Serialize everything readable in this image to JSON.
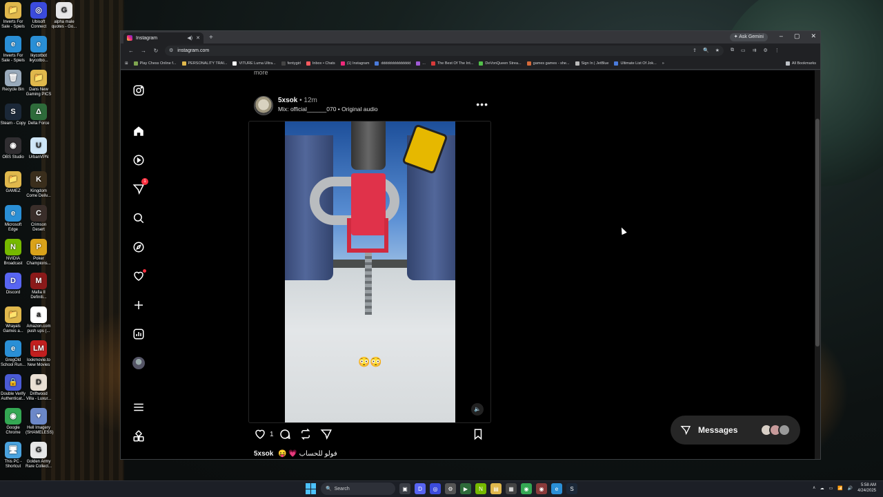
{
  "desktop": {
    "icons": [
      {
        "label": "Inverts For Sale - Spiels",
        "glyph": "📁",
        "color": "#e0b84c"
      },
      {
        "label": "Ubisoft Connect",
        "glyph": "◎",
        "color": "#3b4bdc"
      },
      {
        "label": "alpha male quotes - Go...",
        "glyph": "G",
        "color": "#e7e7e7"
      },
      {
        "label": "Inverts For Sale - Spiels",
        "glyph": "e",
        "color": "#2a8fd6"
      },
      {
        "label": "Ikycotbot Ikycotbo...",
        "glyph": "e",
        "color": "#2a8fd6"
      },
      {
        "label": "Recycle Bin",
        "glyph": "🗑",
        "color": "#9ab"
      },
      {
        "label": "Dans New Gaming PICS",
        "glyph": "📁",
        "color": "#e0b84c"
      },
      {
        "label": "Steam - Copy",
        "glyph": "S",
        "color": "#1b2838"
      },
      {
        "label": "Delta Force",
        "glyph": "Δ",
        "color": "#2e6b3a"
      },
      {
        "label": "OBS Studio",
        "glyph": "◉",
        "color": "#302e31"
      },
      {
        "label": "UrbanVPN",
        "glyph": "U",
        "color": "#cfe6f7"
      },
      {
        "label": "GAMEZ",
        "glyph": "📁",
        "color": "#e0b84c"
      },
      {
        "label": "Kingdom Come Deliv...",
        "glyph": "K",
        "color": "#3a2e1c"
      },
      {
        "label": "Microsoft Edge",
        "glyph": "e",
        "color": "#2a8fd6"
      },
      {
        "label": "Crimson Desert",
        "glyph": "C",
        "color": "#3a2e2a"
      },
      {
        "label": "NVIDIA Broadcast",
        "glyph": "N",
        "color": "#76b900"
      },
      {
        "label": "Poker Champions...",
        "glyph": "P",
        "color": "#d9a21a"
      },
      {
        "label": "Discord",
        "glyph": "D",
        "color": "#5865f2"
      },
      {
        "label": "Mafia II Definiti...",
        "glyph": "M",
        "color": "#8b1a1a"
      },
      {
        "label": "Wrayals Games a...",
        "glyph": "📁",
        "color": "#e0b84c"
      },
      {
        "label": "Amazon.com push ups (...",
        "glyph": "a",
        "color": "#ffffff"
      },
      {
        "label": "GregOld School Run...",
        "glyph": "e",
        "color": "#2a8fd6"
      },
      {
        "label": "lookmovie.to New Movies",
        "glyph": "LM",
        "color": "#c21f1f"
      },
      {
        "label": "Double Verify Authenticat...",
        "glyph": "🔒",
        "color": "#4a5bd6"
      },
      {
        "label": "Driftwood Villa - Luxur...",
        "glyph": "D",
        "color": "#e9e0d4"
      },
      {
        "label": "Google Chrome",
        "glyph": "◉",
        "color": "#34a853"
      },
      {
        "label": "Hell Imagery (SHAMELESS)",
        "glyph": "♥",
        "color": "#6c88c8"
      },
      {
        "label": "This PC - Shortcut",
        "glyph": "🖥",
        "color": "#4aa3df"
      },
      {
        "label": "Golden Army Rare Collect...",
        "glyph": "G",
        "color": "#e7e7e7"
      }
    ]
  },
  "browser": {
    "tab_title": "Instagram",
    "new_tab": "+",
    "ask_gemini": "Ask Gemini",
    "window_controls": [
      "–",
      "▢",
      "✕"
    ],
    "url": "instagram.com",
    "nav": {
      "back": "←",
      "forward": "→",
      "reload": "↻",
      "apps": "⊞"
    },
    "omnibox_icons": [
      "⇪",
      "🔍",
      "★"
    ],
    "toolbar_icons": [
      "⧉",
      "▭",
      "⇉",
      "⚙",
      "⋮"
    ],
    "bookmarks": [
      {
        "label": "Play Chess Online f...",
        "color": "#7fa650"
      },
      {
        "label": "PERSONALITY TRAI...",
        "color": "#e0b84c"
      },
      {
        "label": "VITURE Luma Ultra...",
        "color": "#ffffff"
      },
      {
        "label": "fentygirl",
        "color": "#444444"
      },
      {
        "label": "Inbox • Chats",
        "color": "#ff5a5f"
      },
      {
        "label": "(1) Instagram",
        "color": "#ee2a7b"
      },
      {
        "label": "dddddddddddddd",
        "color": "#4a7bdc"
      },
      {
        "label": "...",
        "color": "#a05ad6"
      },
      {
        "label": "The Best Of The Int...",
        "color": "#d63a3a"
      },
      {
        "label": "DeVonQueen Strea...",
        "color": "#53c04a"
      },
      {
        "label": "games games - she...",
        "color": "#d66a3a"
      },
      {
        "label": "Sign In | JetBlue",
        "color": "#bbbbbb"
      },
      {
        "label": "Ultimate List Of Jok...",
        "color": "#4a7bdc"
      }
    ],
    "bookmarks_overflow": "»",
    "all_bookmarks": "All Bookmarks"
  },
  "instagram": {
    "more_text": "more",
    "post": {
      "username": "5xsok",
      "time": " • 12m",
      "audio": "Mix: official______070 • Original audio",
      "more_menu": "•••",
      "video_emoji": "😳😳",
      "mute": "🔈",
      "like_count": "1",
      "caption_user": "5xsok",
      "caption_text": "😝 💗 فولو للحساب"
    },
    "messages_label": "Messages"
  },
  "taskbar": {
    "search_placeholder": "Search",
    "time": "5:58 AM",
    "date": "4/24/2025",
    "tray": [
      "ʌ",
      "☁",
      "▭",
      "📶",
      "🔊"
    ]
  }
}
